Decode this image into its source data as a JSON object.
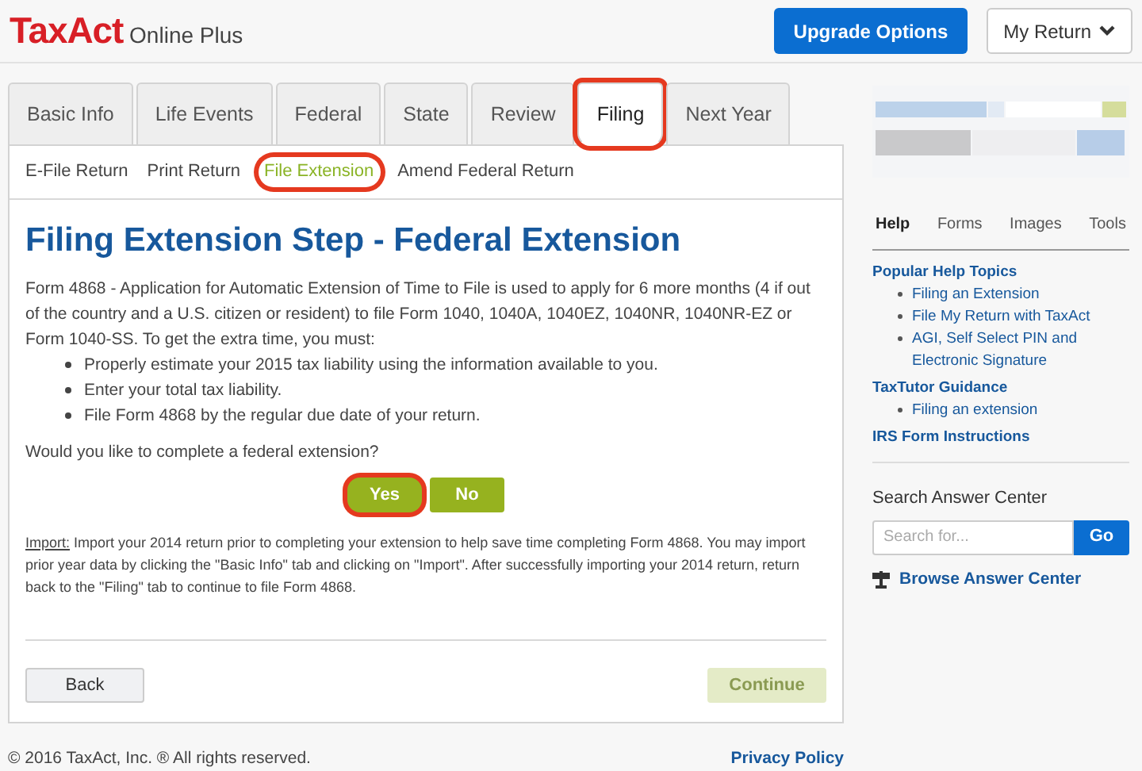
{
  "header": {
    "logo": "TaxAct",
    "product": "Online Plus",
    "upgrade_button": "Upgrade Options",
    "my_return_button": "My Return"
  },
  "tabs": [
    {
      "label": "Basic Info",
      "selected": false,
      "highlighted": false
    },
    {
      "label": "Life Events",
      "selected": false,
      "highlighted": false
    },
    {
      "label": "Federal",
      "selected": false,
      "highlighted": false
    },
    {
      "label": "State",
      "selected": false,
      "highlighted": false
    },
    {
      "label": "Review",
      "selected": false,
      "highlighted": false
    },
    {
      "label": "Filing",
      "selected": true,
      "highlighted": true
    },
    {
      "label": "Next Year",
      "selected": false,
      "highlighted": false
    }
  ],
  "subtabs": [
    {
      "label": "E-File Return",
      "selected": false,
      "highlighted": false
    },
    {
      "label": "Print Return",
      "selected": false,
      "highlighted": false
    },
    {
      "label": "File Extension",
      "selected": true,
      "highlighted": true
    },
    {
      "label": "Amend Federal Return",
      "selected": false,
      "highlighted": false
    }
  ],
  "content": {
    "title": "Filing Extension Step - Federal Extension",
    "intro": "Form 4868 - Application for Automatic Extension of Time to File is used to apply for 6 more months (4 if out of the country and a U.S. citizen or resident) to file Form 1040, 1040A, 1040EZ, 1040NR, 1040NR-EZ or Form 1040-SS. To get the extra time, you must:",
    "bullets": [
      "Properly estimate your 2015 tax liability using the information available to you.",
      "Enter your total tax liability.",
      "File Form 4868 by the regular due date of your return."
    ],
    "question": "Would you like to complete a federal extension?",
    "answers": [
      {
        "label": "Yes",
        "highlighted": true
      },
      {
        "label": "No",
        "highlighted": false
      }
    ],
    "import_label": "Import:",
    "import_text": "Import your 2014 return prior to completing your extension to help save time completing Form 4868. You may import prior year data by clicking the \"Basic Info\" tab and clicking on \"Import\". After successfully importing your 2014 return, return back to the \"Filing\" tab to continue to file Form 4868.",
    "back_button": "Back",
    "continue_button": {
      "label": "Continue",
      "disabled": true
    }
  },
  "footer": {
    "copyright": "© 2016 TaxAct, Inc. ® All rights reserved.",
    "privacy_link": "Privacy Policy"
  },
  "sidebar": {
    "tabs": [
      {
        "label": "Help",
        "selected": true
      },
      {
        "label": "Forms",
        "selected": false
      },
      {
        "label": "Images",
        "selected": false
      },
      {
        "label": "Tools",
        "selected": false
      }
    ],
    "sections": [
      {
        "heading": "Popular Help Topics",
        "links": [
          "Filing an Extension",
          "File My Return with TaxAct",
          "AGI, Self Select PIN and Electronic Signature"
        ]
      },
      {
        "heading": "TaxTutor Guidance",
        "links": [
          "Filing an extension"
        ]
      },
      {
        "heading": "IRS Form Instructions"
      }
    ],
    "search_title": "Search Answer Center",
    "search_placeholder": "Search for...",
    "go_button": "Go",
    "browse_link": "Browse Answer Center"
  }
}
